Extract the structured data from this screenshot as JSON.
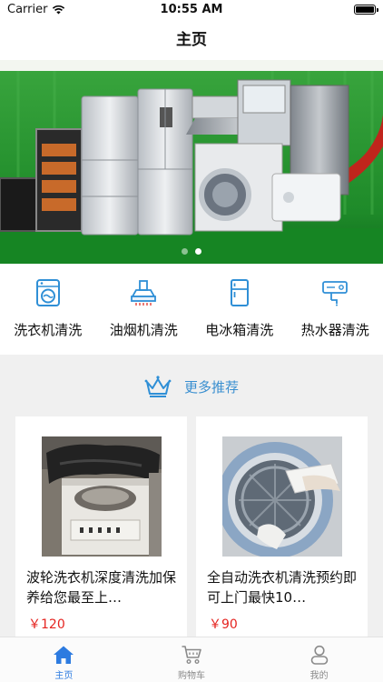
{
  "status_bar": {
    "carrier": "Carrier",
    "time": "10:55 AM"
  },
  "nav": {
    "title": "主页"
  },
  "banner": {
    "page_count": 2,
    "active_page": 2
  },
  "services": [
    {
      "label": "洗衣机清洗",
      "icon": "washing-machine-icon"
    },
    {
      "label": "油烟机清洗",
      "icon": "range-hood-icon"
    },
    {
      "label": "电冰箱清洗",
      "icon": "refrigerator-icon"
    },
    {
      "label": "热水器清洗",
      "icon": "water-heater-icon"
    }
  ],
  "recommend": {
    "label": "更多推荐",
    "icon": "crown-icon",
    "items": [
      {
        "title": "波轮洗衣机深度清洗加保养给您最至上…",
        "price": "￥120",
        "image": "top-load-washer-photo"
      },
      {
        "title": "全自动洗衣机清洗预约即可上门最快10…",
        "price": "￥90",
        "image": "front-load-washer-drum-photo"
      }
    ]
  },
  "tabs": [
    {
      "label": "主页",
      "icon": "home-icon",
      "active": true
    },
    {
      "label": "购物车",
      "icon": "cart-icon",
      "active": false
    },
    {
      "label": "我的",
      "icon": "user-icon",
      "active": false
    }
  ],
  "colors": {
    "accent": "#2d7be0",
    "price": "#e52420",
    "icon": "#3a8fd0",
    "banner_bg": "#1f8a2a"
  }
}
